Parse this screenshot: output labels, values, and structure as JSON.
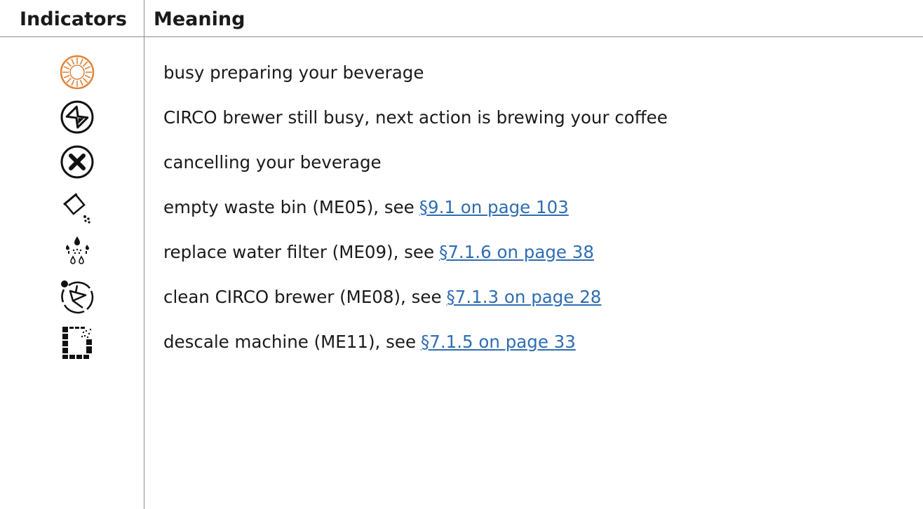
{
  "header": {
    "indicators_label": "Indicators",
    "meaning_label": "Meaning"
  },
  "rows": [
    {
      "icon": "busy-sun-icon",
      "meaning": "busy preparing your beverage",
      "link": ""
    },
    {
      "icon": "hourglass-icon",
      "meaning": "CIRCO brewer still busy, next action is brewing your coffee",
      "link": ""
    },
    {
      "icon": "cancel-x-icon",
      "meaning": "cancelling your beverage",
      "link": ""
    },
    {
      "icon": "waste-bin-icon",
      "meaning": "empty waste bin (ME05), see",
      "link": "§9.1 on page 103"
    },
    {
      "icon": "water-filter-icon",
      "meaning": "replace water filter (ME09), see",
      "link": "§7.1.6 on page 38"
    },
    {
      "icon": "brewer-clean-icon",
      "meaning": "clean CIRCO brewer (ME08), see",
      "link": "§7.1.3 on page 28"
    },
    {
      "icon": "descale-icon",
      "meaning": "descale machine (ME11), see",
      "link": "§7.1.5 on page 33"
    }
  ],
  "colors": {
    "busy_icon": "#e0843a",
    "link": "#2f6db2",
    "rule": "#8c8c8c"
  }
}
